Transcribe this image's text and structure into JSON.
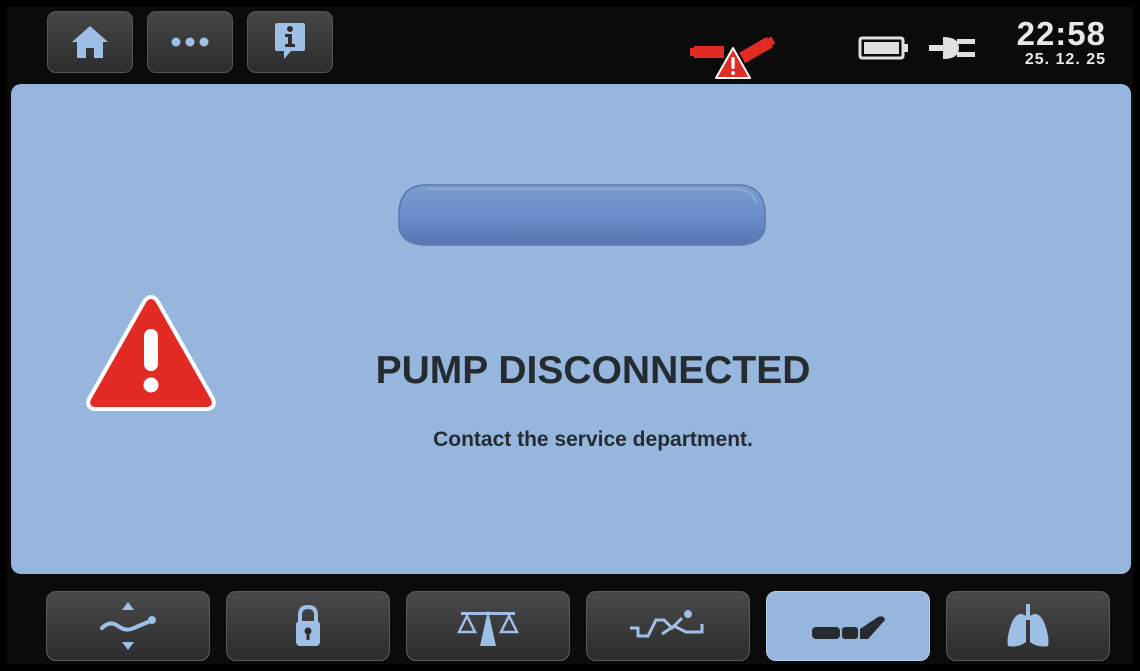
{
  "topbar": {
    "buttons": [
      {
        "name": "home-button",
        "icon": "home-icon"
      },
      {
        "name": "more-button",
        "icon": "more-icon"
      },
      {
        "name": "info-button",
        "icon": "info-icon"
      }
    ],
    "alarm_icon": "pump-disconnected-warning-icon",
    "battery_icon": "battery-icon",
    "power_icon": "plug-icon",
    "time": "22:58",
    "date": "25. 12. 25"
  },
  "alert": {
    "title": "PUMP DISCONNECTED",
    "message": "Contact the service department.",
    "icon": "warning-triangle-icon"
  },
  "bottombar": {
    "tabs": [
      {
        "name": "tab-position-adjust",
        "icon": "position-adjust-icon",
        "active": false
      },
      {
        "name": "tab-lock",
        "icon": "lock-icon",
        "active": false
      },
      {
        "name": "tab-scale",
        "icon": "scale-icon",
        "active": false
      },
      {
        "name": "tab-bed-exit",
        "icon": "bed-exit-icon",
        "active": false
      },
      {
        "name": "tab-mattress",
        "icon": "mattress-icon",
        "active": true
      },
      {
        "name": "tab-lungs",
        "icon": "lungs-icon",
        "active": false
      }
    ]
  },
  "colors": {
    "panel": "#96b6de",
    "alarm_red": "#e32b26",
    "text_dark": "#262b31"
  }
}
